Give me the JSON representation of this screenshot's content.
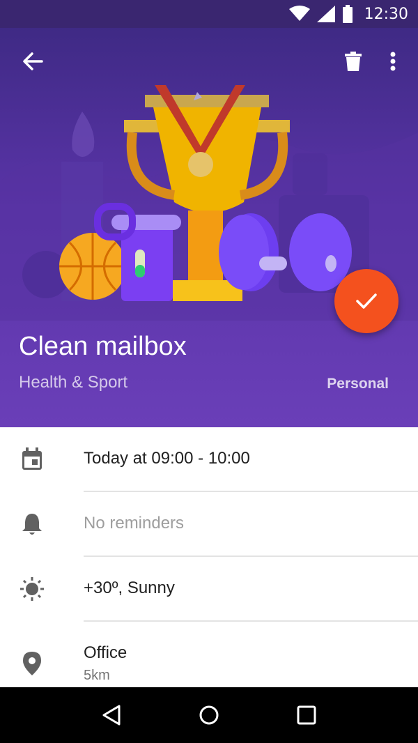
{
  "status_bar": {
    "time": "12:30",
    "icons": [
      "wifi-icon",
      "signal-icon",
      "battery-icon"
    ]
  },
  "app_bar": {
    "back_icon": "arrow-back-icon",
    "delete_icon": "trash-icon",
    "more_icon": "more-vert-icon"
  },
  "task": {
    "title": "Clean mailbox",
    "category": "Health & Sport",
    "list": "Personal"
  },
  "fab": {
    "icon": "check-icon",
    "color": "#f4511e"
  },
  "details": [
    {
      "icon": "calendar-icon",
      "text": "Today at 09:00 - 10:00",
      "muted": false
    },
    {
      "icon": "bell-icon",
      "text": "No reminders",
      "muted": true
    },
    {
      "icon": "sun-icon",
      "text": "+30º, Sunny",
      "muted": false
    },
    {
      "icon": "location-pin-icon",
      "text": "Office",
      "subtext": "5km",
      "muted": false
    }
  ],
  "nav_bar": {
    "back": "triangle-back-icon",
    "home": "circle-home-icon",
    "recents": "square-recents-icon"
  },
  "colors": {
    "primary": "#5a34a8",
    "status_bar": "#3a2670",
    "accent": "#f4511e"
  }
}
